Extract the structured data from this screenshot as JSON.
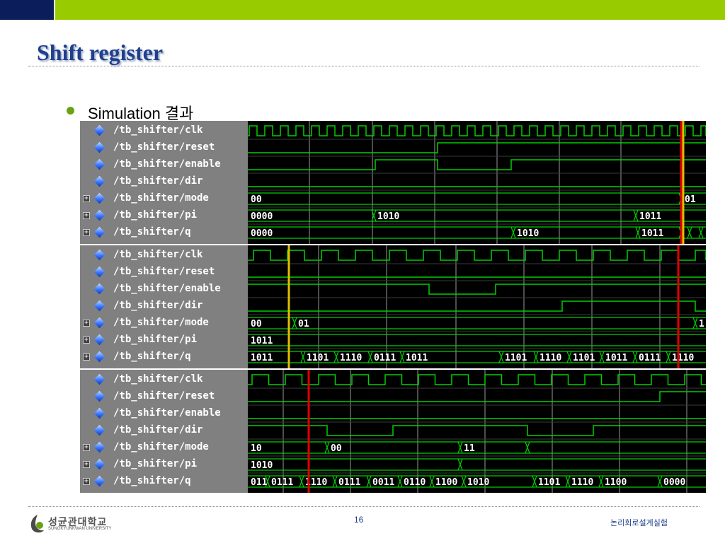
{
  "slide": {
    "title": "Shift register",
    "bullet": "Simulation 결과",
    "page_number": "16",
    "course_name": "논리회로설계실험",
    "university_korean": "성균관대학교",
    "university_english": "SUNGKYUNKWAN UNIVERSITY"
  },
  "colors": {
    "top_bar_dark": "#0b1e5b",
    "top_bar_green": "#99cc00",
    "title": "#1f3f8f",
    "bullet": "#6aa312",
    "wave_background": "#000000",
    "name_panel": "#808080",
    "signal": "#00d000",
    "grid": "#9a9a9a",
    "cursor_yellow": "#e0c000",
    "cursor_red": "#e00000"
  },
  "waveform_panels": [
    {
      "signals": [
        {
          "name": "/tb_shifter/clk",
          "icon": "diamond-icon",
          "bus": false
        },
        {
          "name": "/tb_shifter/reset",
          "icon": "diamond-icon",
          "bus": false
        },
        {
          "name": "/tb_shifter/enable",
          "icon": "diamond-icon",
          "bus": false
        },
        {
          "name": "/tb_shifter/dir",
          "icon": "diamond-icon",
          "bus": false
        },
        {
          "name": "/tb_shifter/mode",
          "icon": "diamond-icon",
          "bus": true
        },
        {
          "name": "/tb_shifter/pi",
          "icon": "diamond-icon",
          "bus": true
        },
        {
          "name": "/tb_shifter/q",
          "icon": "diamond-icon",
          "bus": true
        }
      ],
      "bus_values": {
        "mode": [
          "00",
          "01"
        ],
        "pi": [
          "0000",
          "1010",
          "1011"
        ],
        "q": [
          "0000",
          "1010",
          "1011"
        ]
      },
      "cursors": [
        "yellow",
        "red"
      ]
    },
    {
      "signals": [
        {
          "name": "/tb_shifter/clk",
          "icon": "diamond-icon",
          "bus": false
        },
        {
          "name": "/tb_shifter/reset",
          "icon": "diamond-icon",
          "bus": false
        },
        {
          "name": "/tb_shifter/enable",
          "icon": "diamond-icon",
          "bus": false
        },
        {
          "name": "/tb_shifter/dir",
          "icon": "diamond-icon",
          "bus": false
        },
        {
          "name": "/tb_shifter/mode",
          "icon": "diamond-icon",
          "bus": true
        },
        {
          "name": "/tb_shifter/pi",
          "icon": "diamond-icon",
          "bus": true
        },
        {
          "name": "/tb_shifter/q",
          "icon": "diamond-icon",
          "bus": true
        }
      ],
      "bus_values": {
        "mode": [
          "00",
          "01",
          "1"
        ],
        "pi": [
          "1011"
        ],
        "q": [
          "1011",
          "1101",
          "1110",
          "0111",
          "1011",
          "1101",
          "1110",
          "1101",
          "1011",
          "0111",
          "1110"
        ]
      },
      "cursors": [
        "yellow",
        "red"
      ]
    },
    {
      "signals": [
        {
          "name": "/tb_shifter/clk",
          "icon": "diamond-icon",
          "bus": false
        },
        {
          "name": "/tb_shifter/reset",
          "icon": "diamond-icon",
          "bus": false
        },
        {
          "name": "/tb_shifter/enable",
          "icon": "diamond-icon",
          "bus": false
        },
        {
          "name": "/tb_shifter/dir",
          "icon": "diamond-icon",
          "bus": false
        },
        {
          "name": "/tb_shifter/mode",
          "icon": "diamond-icon",
          "bus": true
        },
        {
          "name": "/tb_shifter/pi",
          "icon": "diamond-icon",
          "bus": true
        },
        {
          "name": "/tb_shifter/q",
          "icon": "diamond-icon",
          "bus": true
        }
      ],
      "bus_values": {
        "mode": [
          "10",
          "00",
          "11"
        ],
        "pi": [
          "1010"
        ],
        "q": [
          "011",
          "0111",
          "1110",
          "0111",
          "0011",
          "0110",
          "1100",
          "1010",
          "1101",
          "1110",
          "1100",
          "0000"
        ]
      },
      "cursors": [
        "red"
      ]
    }
  ]
}
